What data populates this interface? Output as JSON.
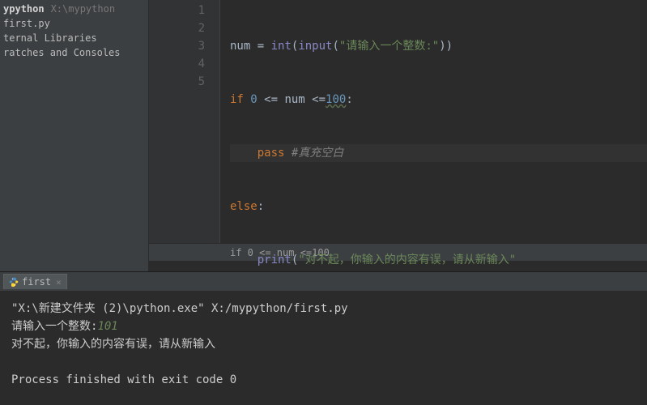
{
  "sidebar": {
    "project": {
      "name": "ypython",
      "path": "X:\\mypython"
    },
    "file": "first.py",
    "external": "ternal Libraries",
    "scratches": "ratches and Consoles"
  },
  "gutter": [
    "1",
    "2",
    "3",
    "4",
    "5"
  ],
  "code": {
    "l1": {
      "id": "num",
      "eq": " = ",
      "fn": "int",
      "p1": "(",
      "inp": "input",
      "p2": "(",
      "str": "\"请输入一个整数:\"",
      "p3": "))"
    },
    "l2": {
      "kw": "if",
      "sp": " ",
      "n0": "0",
      "op1": " <= ",
      "id": "num",
      "op2": " <=",
      "n100": "100",
      "colon": ":"
    },
    "l3": {
      "kw": "pass",
      "sp": " ",
      "comment": "#真充空白"
    },
    "l4": {
      "kw": "else",
      "colon": ":"
    },
    "l5": {
      "fn": "print",
      "p1": "(",
      "str": "\"对不起，你输入的内容有误，请从新输入\""
    }
  },
  "breadcrumb": "if 0 <= num <=100",
  "run": {
    "tab": "first",
    "line1": "\"X:\\新建文件夹 (2)\\python.exe\" X:/mypython/first.py",
    "prompt": "请输入一个整数:",
    "input": "101",
    "output": "对不起，你输入的内容有误，请从新输入",
    "exit": "Process finished with exit code 0"
  }
}
